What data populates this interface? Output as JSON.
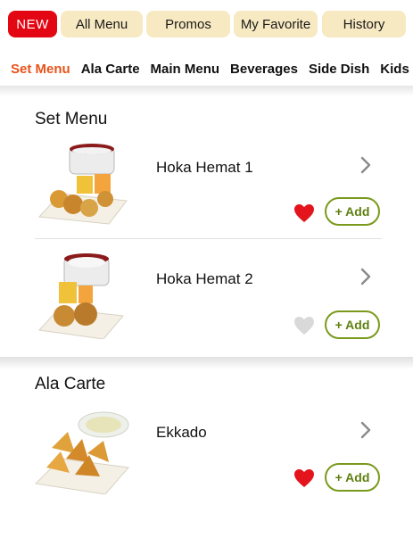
{
  "top_tabs": [
    "NEW",
    "All Menu",
    "Promos",
    "My Favorite",
    "History"
  ],
  "categories": [
    "Set Menu",
    "Ala Carte",
    "Main Menu",
    "Beverages",
    "Side Dish",
    "Kids"
  ],
  "active_category": "Set Menu",
  "sections": [
    {
      "title": "Set Menu",
      "items": [
        {
          "name": "Hoka Hemat 1",
          "favorite": true,
          "add_label": "+ Add"
        },
        {
          "name": "Hoka Hemat 2",
          "favorite": false,
          "add_label": "+ Add"
        }
      ]
    },
    {
      "title": "Ala Carte",
      "items": [
        {
          "name": "Ekkado",
          "favorite": true,
          "add_label": "+ Add"
        }
      ]
    }
  ],
  "colors": {
    "brand_red": "#e30613",
    "pill_bg": "#f7e9c1",
    "active_category": "#e8531a",
    "add_green": "#7a9a1b",
    "heart_on": "#e3141c",
    "heart_off": "#d9d9d9"
  }
}
